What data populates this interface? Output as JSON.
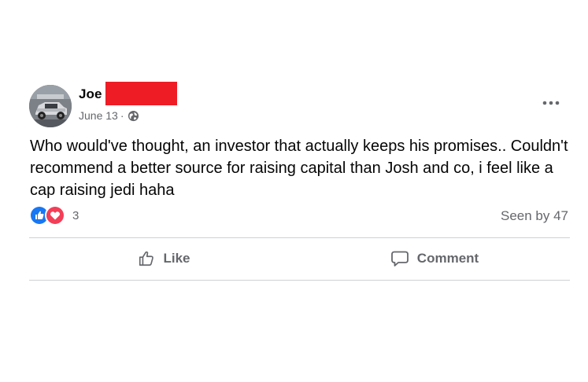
{
  "post": {
    "author": {
      "name": "Joe",
      "name_redacted": true
    },
    "date": "June 13",
    "separator": "·",
    "audience_icon": "globe-icon",
    "menu_icon": "more-options-icon",
    "text": "Who would've thought, an investor that actually keeps his promises.. Couldn't recommend a better source for raising capital than Josh and co, i feel like a cap raising jedi haha",
    "reactions": {
      "icons": [
        "like-reaction-icon",
        "love-reaction-icon"
      ],
      "count": "3"
    },
    "seen_by": "Seen by 47",
    "actions": {
      "like_label": "Like",
      "comment_label": "Comment"
    }
  },
  "colors": {
    "secondary_text": "#65676b",
    "like_blue": "#1877f2",
    "love_red": "#f33e58",
    "redaction": "#ee1c25",
    "divider": "#ced0d4"
  }
}
